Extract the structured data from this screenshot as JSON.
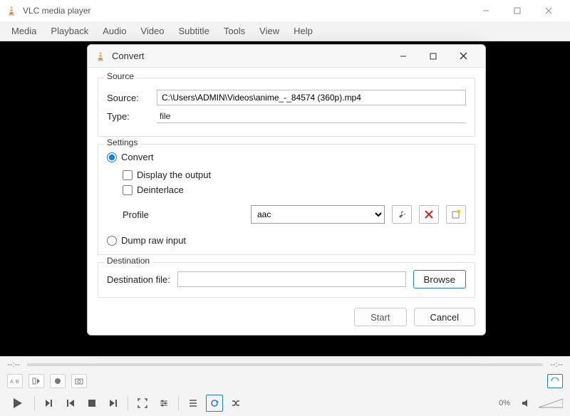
{
  "main": {
    "title": "VLC media player",
    "menus": [
      "Media",
      "Playback",
      "Audio",
      "Video",
      "Subtitle",
      "Tools",
      "View",
      "Help"
    ],
    "time_left": "--:--",
    "time_right": "--:--",
    "volume_pct": "0%"
  },
  "dialog": {
    "title": "Convert",
    "source_group": "Source",
    "source_label": "Source:",
    "source_value": "C:\\Users\\ADMIN\\Videos\\anime_-_84574 (360p).mp4",
    "type_label": "Type:",
    "type_value": "file",
    "settings_group": "Settings",
    "convert_label": "Convert",
    "display_output_label": "Display the output",
    "deinterlace_label": "Deinterlace",
    "profile_label": "Profile",
    "profile_value": "aac",
    "dump_label": "Dump raw input",
    "destination_group": "Destination",
    "dest_file_label": "Destination file:",
    "dest_file_value": "",
    "browse_label": "Browse",
    "start_label": "Start",
    "cancel_label": "Cancel"
  }
}
